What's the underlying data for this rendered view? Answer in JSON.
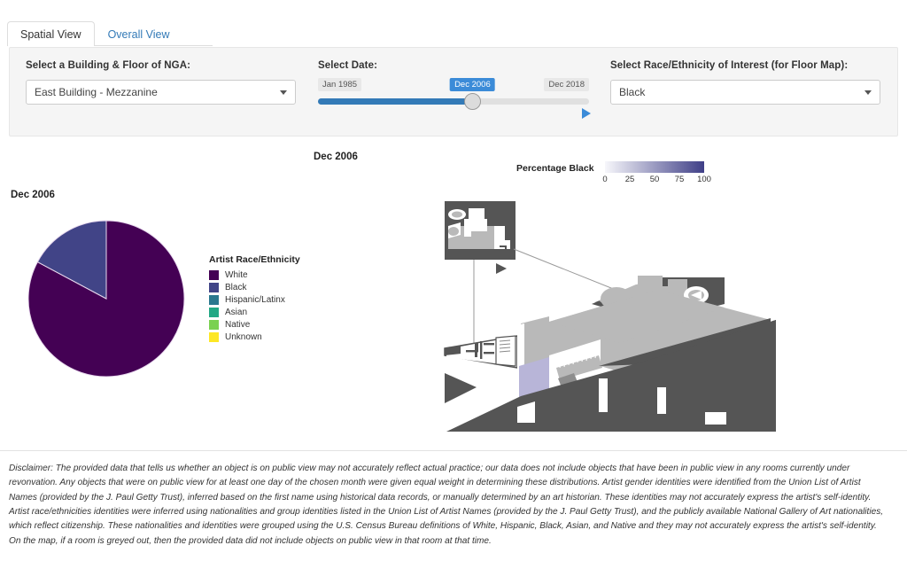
{
  "tabs": [
    {
      "label": "Spatial View",
      "active": true
    },
    {
      "label": "Overall View",
      "active": false
    }
  ],
  "controls": {
    "building": {
      "label": "Select a Building & Floor of NGA:",
      "value": "East Building - Mezzanine"
    },
    "date": {
      "label": "Select Date:",
      "min_label": "Jan 1985",
      "max_label": "Dec 2018",
      "current_label": "Dec 2006",
      "fill_percent": 57,
      "play_icon": "play-triangle-icon"
    },
    "race": {
      "label": "Select Race/Ethnicity of Interest (for Floor Map):",
      "value": "Black"
    }
  },
  "map_panel": {
    "title": "Dec 2006",
    "colorbar": {
      "title": "Percentage Black",
      "ticks": [
        "0",
        "25",
        "50",
        "75",
        "100"
      ],
      "low_color": "#f7f7fb",
      "high_color": "#3f3f87"
    },
    "highlight_color": "#b8b5d8",
    "room_color": "#b9b9b9",
    "wall_color": "#555555"
  },
  "pie_panel": {
    "title": "Dec 2006",
    "legend_title": "Artist Race/Ethnicity"
  },
  "chart_data": {
    "type": "pie",
    "title": "Dec 2006",
    "legend_title": "Artist Race/Ethnicity",
    "legend_position": "right",
    "categories": [
      "White",
      "Black",
      "Hispanic/Latinx",
      "Asian",
      "Native",
      "Unknown"
    ],
    "colors": [
      "#440154",
      "#414487",
      "#2a788e",
      "#22a884",
      "#7ad151",
      "#fde725"
    ],
    "values": [
      82.8,
      17.2,
      0,
      0,
      0,
      0
    ],
    "unit": "percent",
    "start_angle_deg": 0,
    "direction": "clockwise"
  },
  "disclaimer": {
    "text": "Disclaimer: The provided data that tells us whether an object is on public view may not accurately reflect actual practice; our data does not include objects that have been in public view in any rooms currently under revonvation. Any objects that were on public view for at least one day of the chosen month were given equal weight in determining these distributions. Artist gender identities were identified from the Union List of Artist Names (provided by the J. Paul Getty Trust), inferred based on the first name using historical data records, or manually determined by an art historian. These identities may not accurately express the artist's self-identity. Artist race/ethnicities identities were inferred using nationalities and group identities listed in the Union List of Artist Names (provided by the J. Paul Getty Trust), and the publicly available National Gallery of Art nationalities, which reflect citizenship. These nationalities and identities were grouped using the U.S. Census Bureau definitions of White, Hispanic, Black, Asian, and Native and they may not accurately express the artist's self-identity. On the map, if a room is greyed out, then the provided data did not include objects on public view in that room at that time."
  }
}
